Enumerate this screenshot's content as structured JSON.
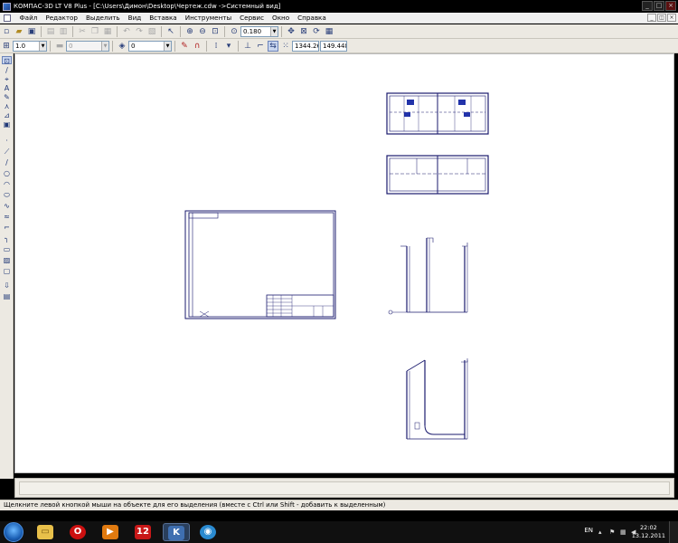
{
  "window": {
    "title": "КОМПАС-3D LT V8 Plus - [C:\\Users\\Димон\\Desktop\\Чертеж.cdw ->Системный вид]",
    "min_label": "_",
    "max_label": "□",
    "close_label": "×"
  },
  "menu": {
    "items": [
      "Файл",
      "Редактор",
      "Выделить",
      "Вид",
      "Вставка",
      "Инструменты",
      "Сервис",
      "Окно",
      "Справка"
    ]
  },
  "toolbar_main": {
    "zoom_value": "0.180"
  },
  "toolbar_props": {
    "scale_value": "1.0",
    "style_value": "0",
    "layer_value": "0",
    "coord_x": "1344.26",
    "coord_y": "149.448"
  },
  "statusbar": {
    "hint": "Щелкните левой кнопкой мыши на объекте для его выделения (вместе с Ctrl или Shift - добавить к выделенным)"
  },
  "taskbar": {
    "apps": [
      {
        "name": "explorer",
        "glyph": "▭",
        "color": "#e8c04a"
      },
      {
        "name": "opera",
        "glyph": "O",
        "color": "#cc1010"
      },
      {
        "name": "media-player",
        "glyph": "▶",
        "color": "#e07a10"
      },
      {
        "name": "opera-12",
        "glyph": "12",
        "color": "#c81818"
      },
      {
        "name": "kompas",
        "glyph": "K",
        "color": "#3f6fb0"
      },
      {
        "name": "network",
        "glyph": "◉",
        "color": "#2a8ad0"
      }
    ],
    "language": "EN",
    "time": "22:02",
    "date": "13.12.2011"
  }
}
